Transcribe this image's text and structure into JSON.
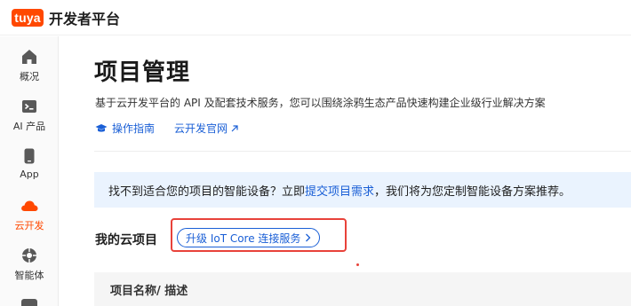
{
  "brand": {
    "logo_text": "tuya",
    "title": "开发者平台",
    "logo_color": "#ff4800"
  },
  "sidebar": {
    "items": [
      {
        "label": "概况",
        "icon": "home-icon",
        "active": false
      },
      {
        "label": "AI 产品",
        "icon": "terminal-icon",
        "active": false
      },
      {
        "label": "App",
        "icon": "phone-icon",
        "active": false
      },
      {
        "label": "云开发",
        "icon": "cloud-icon",
        "active": true
      },
      {
        "label": "智能体",
        "icon": "agent-icon",
        "active": false
      }
    ]
  },
  "main": {
    "title": "项目管理",
    "description": "基于云开发平台的 API 及配套技术服务，您可以围绕涂鸦生态产品快速构建企业级行业解决方案",
    "links": [
      {
        "label": "操作指南",
        "icon": "graduation-cap-icon"
      },
      {
        "label": "云开发官网",
        "icon": "external-link-icon"
      }
    ],
    "banner": {
      "prefix": "找不到适合您的项目的智能设备？立即",
      "link": "提交项目需求",
      "suffix": "，我们将为您定制智能设备方案推荐。"
    },
    "section_title": "我的云项目",
    "upgrade_button": "升级 IoT Core 连接服务",
    "table": {
      "columns": [
        "项目名称/ 描述"
      ]
    }
  },
  "colors": {
    "accent": "#1a5fd6",
    "brand": "#ff4800",
    "highlight_box": "#e8423a",
    "banner_bg": "#eaf3fe"
  }
}
